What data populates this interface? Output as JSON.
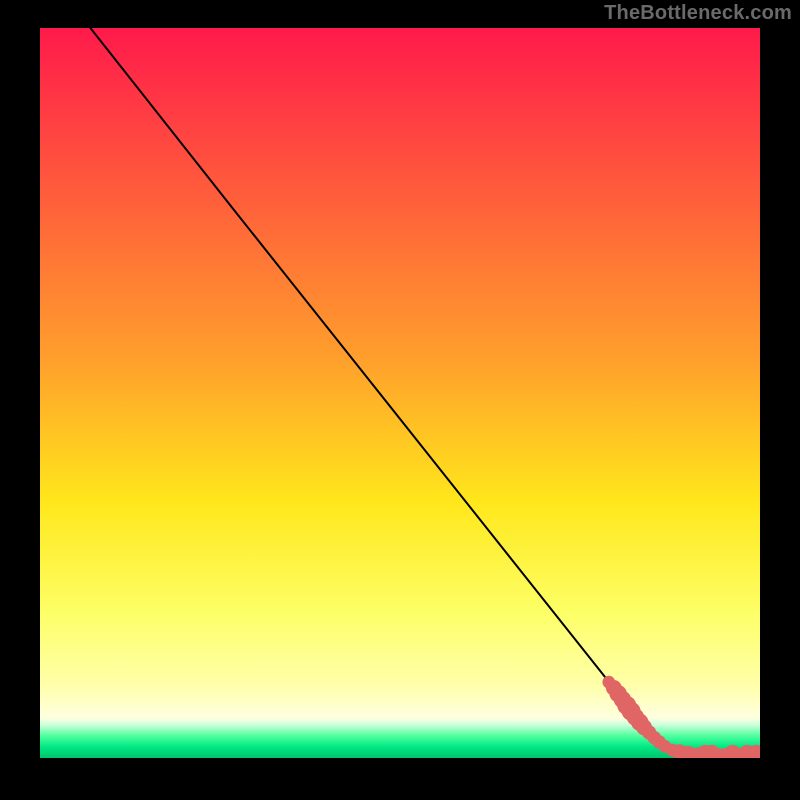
{
  "attribution": "TheBottleneck.com",
  "chart_data": {
    "type": "line",
    "title": "",
    "xlabel": "",
    "ylabel": "",
    "xlim": [
      0,
      100
    ],
    "ylim": [
      0,
      100
    ],
    "grid": false,
    "legend": false,
    "background_gradient": {
      "stops": [
        {
          "offset": 0.0,
          "color": "#ff1a4b"
        },
        {
          "offset": 0.45,
          "color": "#ff9e2c"
        },
        {
          "offset": 0.65,
          "color": "#ffe71b"
        },
        {
          "offset": 0.8,
          "color": "#fdff66"
        },
        {
          "offset": 0.9,
          "color": "#ffffaa"
        },
        {
          "offset": 0.945,
          "color": "#ffffe0"
        },
        {
          "offset": 0.955,
          "color": "#c9ffda"
        },
        {
          "offset": 0.97,
          "color": "#4dff9c"
        },
        {
          "offset": 0.985,
          "color": "#00e884"
        },
        {
          "offset": 1.0,
          "color": "#00c46c"
        }
      ]
    },
    "series": [
      {
        "name": "bottleneck-curve",
        "color": "#000000",
        "points": [
          {
            "x": 7.0,
            "y": 100.0
          },
          {
            "x": 27.0,
            "y": 75.0
          },
          {
            "x": 85.0,
            "y": 3.0
          },
          {
            "x": 90.0,
            "y": 0.6
          },
          {
            "x": 100.0,
            "y": 0.6
          }
        ]
      }
    ],
    "markers": {
      "name": "data-points",
      "color": "#e06666",
      "points": [
        {
          "x": 79.0,
          "y": 10.4,
          "r": 1.6
        },
        {
          "x": 79.7,
          "y": 9.6,
          "r": 2.0
        },
        {
          "x": 80.3,
          "y": 8.8,
          "r": 2.2
        },
        {
          "x": 80.9,
          "y": 8.0,
          "r": 2.2
        },
        {
          "x": 81.5,
          "y": 7.2,
          "r": 2.4
        },
        {
          "x": 82.1,
          "y": 6.4,
          "r": 2.4
        },
        {
          "x": 82.7,
          "y": 5.6,
          "r": 2.2
        },
        {
          "x": 83.3,
          "y": 4.9,
          "r": 2.2
        },
        {
          "x": 83.9,
          "y": 4.2,
          "r": 2.0
        },
        {
          "x": 84.6,
          "y": 3.5,
          "r": 1.8
        },
        {
          "x": 85.3,
          "y": 2.8,
          "r": 1.7
        },
        {
          "x": 86.0,
          "y": 2.2,
          "r": 1.7
        },
        {
          "x": 86.8,
          "y": 1.6,
          "r": 1.6
        },
        {
          "x": 87.8,
          "y": 1.1,
          "r": 1.6
        },
        {
          "x": 88.8,
          "y": 0.8,
          "r": 2.0
        },
        {
          "x": 90.0,
          "y": 0.6,
          "r": 2.0
        },
        {
          "x": 91.3,
          "y": 0.6,
          "r": 1.6
        },
        {
          "x": 92.4,
          "y": 0.6,
          "r": 2.2
        },
        {
          "x": 93.3,
          "y": 0.6,
          "r": 2.2
        },
        {
          "x": 94.2,
          "y": 0.6,
          "r": 1.4
        },
        {
          "x": 95.0,
          "y": 0.6,
          "r": 1.4
        },
        {
          "x": 96.2,
          "y": 0.6,
          "r": 2.2
        },
        {
          "x": 97.2,
          "y": 0.6,
          "r": 1.4
        },
        {
          "x": 98.2,
          "y": 0.6,
          "r": 2.2
        },
        {
          "x": 99.5,
          "y": 0.6,
          "r": 2.2
        }
      ]
    }
  }
}
